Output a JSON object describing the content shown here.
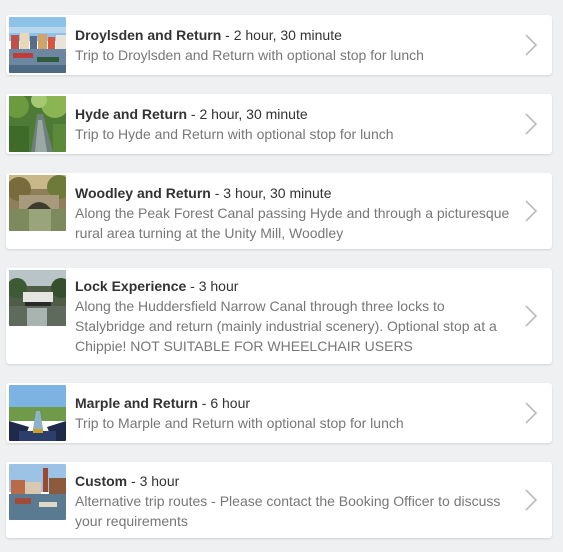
{
  "trips": [
    {
      "title": "Droylsden and Return",
      "duration": " - 2 hour, 30 minute",
      "description": "Trip to Droylsden and Return with optional stop for lunch",
      "thumb_icon": "town-marina-photo"
    },
    {
      "title": "Hyde and Return",
      "duration": " - 2 hour, 30 minute",
      "description": "Trip to Hyde and Return with optional stop for lunch",
      "thumb_icon": "tree-lined-canal-photo"
    },
    {
      "title": "Woodley and Return",
      "duration": " - 3 hour, 30 minute",
      "description": "Along the Peak Forest Canal passing Hyde and through a picturesque rural area turning at the Unity Mill, Woodley",
      "thumb_icon": "stone-bridge-canal-photo"
    },
    {
      "title": "Lock Experience",
      "duration": " - 3 hour",
      "description": "Along the Huddersfield Narrow Canal through three locks to Stalybridge and return (mainly industrial scenery). Optional stop at a Chippie!  NOT SUITABLE FOR WHEELCHAIR USERS",
      "thumb_icon": "canal-lock-photo"
    },
    {
      "title": "Marple and Return",
      "duration": " - 6 hour",
      "description": "Trip to Marple and Return with optional stop for lunch",
      "thumb_icon": "narrowboat-bow-photo"
    },
    {
      "title": "Custom",
      "duration": " - 3 hour",
      "description": "Alternative trip routes - Please contact the Booking Officer to discuss your requirements",
      "thumb_icon": "mill-chimney-canal-photo"
    }
  ],
  "chevron_icon": "chevron-right-icon",
  "colors": {
    "background": "#eef0f2",
    "card": "#ffffff",
    "title_text": "#333333",
    "description_text": "#777777",
    "chevron": "#bbbbbb"
  }
}
